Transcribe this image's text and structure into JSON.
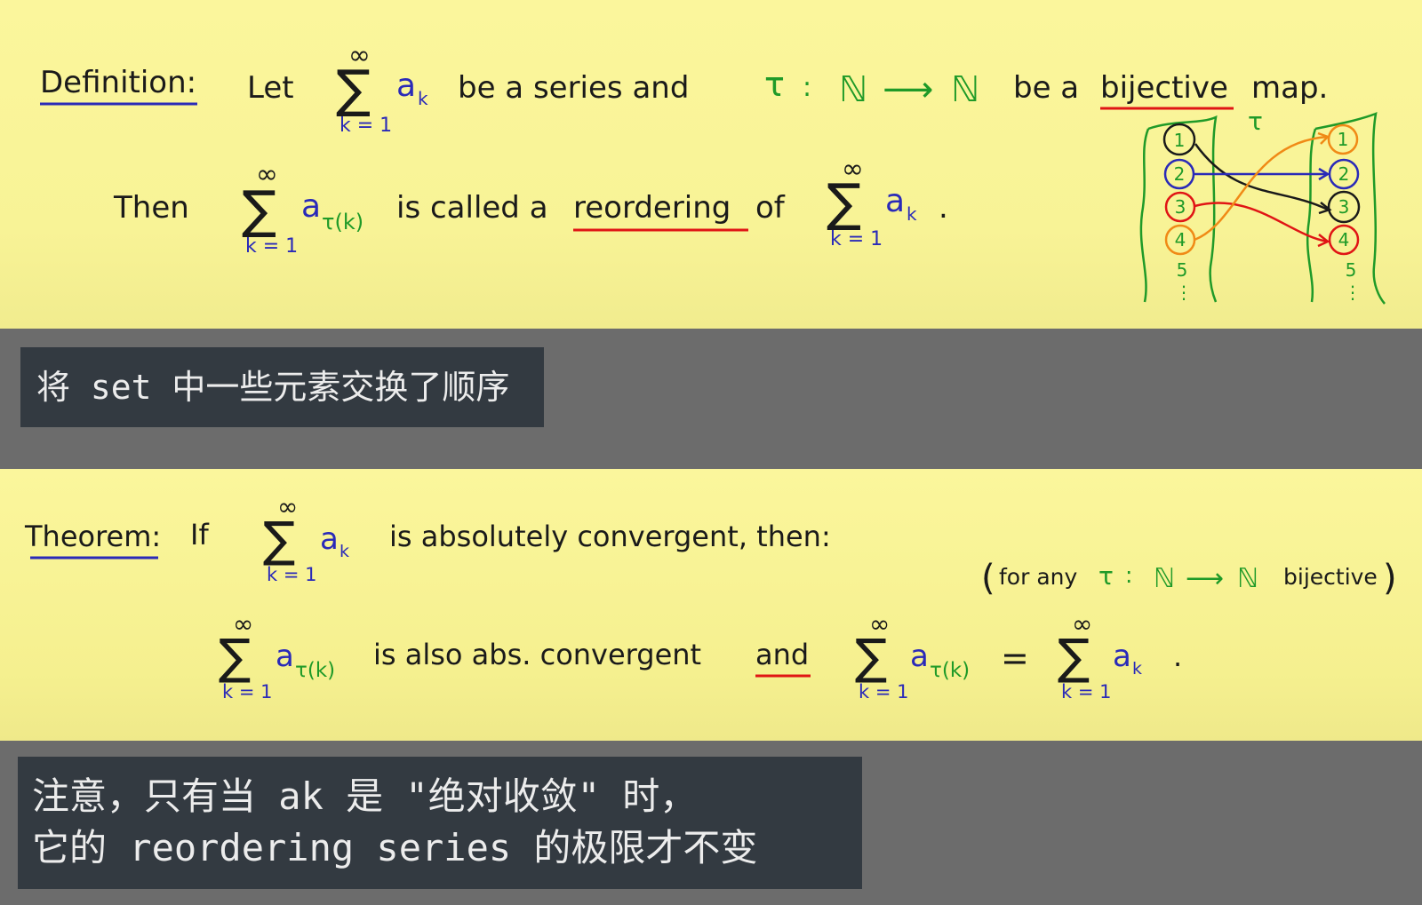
{
  "definition": {
    "label": "Definition:",
    "let_word": "Let",
    "sum_sup": "∞",
    "sum_sub": "k = 1",
    "term_a": "a",
    "term_k": "k",
    "text_series": "be a series and",
    "tau_map_tau": "τ",
    "tau_map_colon": ":",
    "tau_map_N": "ℕ",
    "tau_map_arrow": "⟶",
    "text_be_a": "be a",
    "bijective_word": "bijective",
    "map_word": "map.",
    "then_word": "Then",
    "term_tau_k": "τ(k)",
    "text_called": "is called a",
    "reordering_word": "reordering",
    "of_word": "of",
    "period": ".",
    "diagram": {
      "tau_label": "τ",
      "left_nodes": [
        "1",
        "2",
        "3",
        "4"
      ],
      "right_nodes": [
        "1",
        "2",
        "3",
        "4"
      ],
      "five": "5",
      "dots": "⋮"
    }
  },
  "caption_1": "将 set 中一些元素交换了顺序",
  "theorem": {
    "label": "Theorem:",
    "if_word": "If",
    "text_abs_conv": "is absolutely convergent, then:",
    "paren_for_any": "for any",
    "paren_bijective": "bijective",
    "text_also": "is also abs. convergent",
    "and_word": "and",
    "equals": "=",
    "period": "."
  },
  "caption_2": {
    "line1": "注意，只有当 ak 是 \"绝对收敛\" 时，",
    "line2": "它的 reordering series 的极限才不变"
  },
  "colors": {
    "ink": "#1a1a1a",
    "blue": "#2a2ab8",
    "green": "#1f9a28",
    "red": "#e01515",
    "orange": "#f08a16",
    "panel": "#fbf69c",
    "caption_bg": "#333a41"
  }
}
